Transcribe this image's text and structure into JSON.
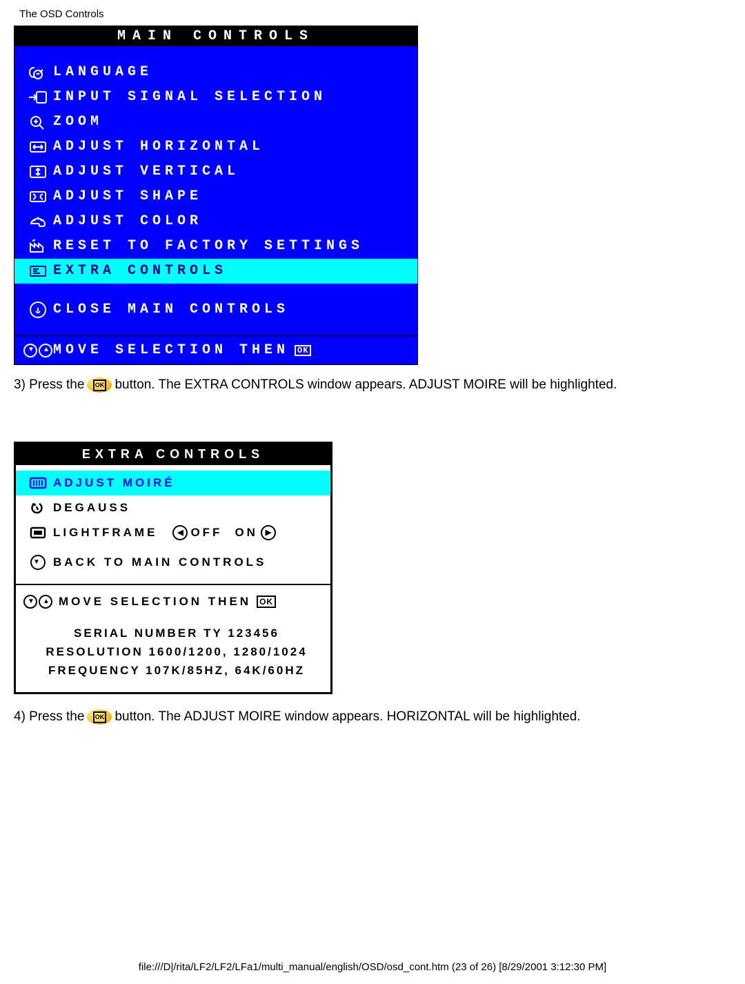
{
  "page": {
    "header": "The OSD Controls",
    "footer": "file:///D|/rita/LF2/LF2/LFa1/multi_manual/english/OSD/osd_cont.htm (23 of 26) [8/29/2001 3:12:30 PM]"
  },
  "main_osd": {
    "title": "MAIN CONTROLS",
    "items": [
      "LANGUAGE",
      "INPUT SIGNAL SELECTION",
      "ZOOM",
      "ADJUST HORIZONTAL",
      "ADJUST VERTICAL",
      "ADJUST SHAPE",
      "ADJUST COLOR",
      "RESET TO FACTORY SETTINGS",
      "EXTRA CONTROLS"
    ],
    "close": "CLOSE MAIN CONTROLS",
    "footer": "MOVE SELECTION THEN",
    "ok": "OK"
  },
  "step3": {
    "prefix": "3) Press the ",
    "suffix": " button. The EXTRA CONTROLS window appears. ADJUST MOIRE will be highlighted."
  },
  "extra_osd": {
    "title": "EXTRA CONTROLS",
    "adjust_moire": "ADJUST MOIRÉ",
    "degauss": "DEGAUSS",
    "lightframe": "LIGHTFRAME",
    "off": "OFF",
    "on": "ON",
    "back": "BACK TO MAIN CONTROLS",
    "move": "MOVE SELECTION THEN",
    "ok": "OK",
    "serial": "SERIAL NUMBER TY 123456",
    "resolution": "RESOLUTION 1600/1200, 1280/1024",
    "frequency": "FREQUENCY 107K/85HZ, 64K/60HZ"
  },
  "step4": {
    "prefix": "4) Press the ",
    "suffix": " button. The ADJUST MOIRE window appears. HORIZONTAL will be highlighted."
  }
}
